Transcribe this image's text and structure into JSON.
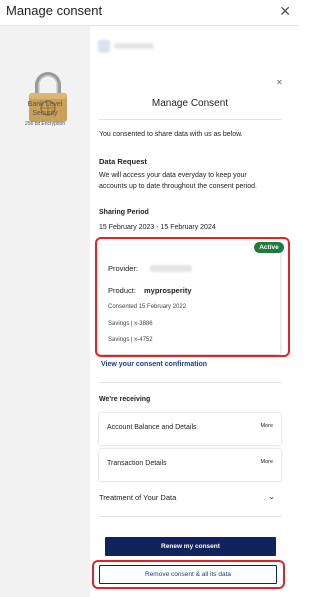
{
  "window": {
    "title": "Manage consent",
    "close_icon": "close-icon"
  },
  "security": {
    "label_line1": "Bank Level",
    "label_line2": "Security",
    "encryption": "256 bit Encryption"
  },
  "card": {
    "title": "Manage Consent",
    "intro": "You consented to share data with us as below.",
    "data_request": {
      "heading": "Data Request",
      "line1": "We will access your data everyday to keep your",
      "line2": "accounts up to date throughout the consent period."
    },
    "sharing_period": {
      "heading": "Sharing Period",
      "value": "15 February 2023 - 15 February 2024"
    },
    "provider": {
      "status": "Active",
      "provider_label": "Provider:",
      "product_label": "Product:",
      "product_value": "myprosperity",
      "consented": "Consented 15 February 2022",
      "account1": "Savings | x-3886",
      "account2": "Savings | x-4752"
    },
    "view_confirmation": "View your consent confirmation",
    "receiving": {
      "heading": "We're receiving",
      "items": [
        {
          "label": "Account Balance and Details",
          "more": "More"
        },
        {
          "label": "Transaction Details",
          "more": "More"
        }
      ]
    },
    "treatment": {
      "label": "Treatment of Your Data",
      "icon": "chevron-down-icon"
    },
    "renew_button": "Renew my consent",
    "remove_button": "Remove consent & all its data"
  },
  "colors": {
    "primary": "#10235c",
    "active": "#1e7a3e",
    "highlight": "#e0242c",
    "link": "#1a3a8a"
  }
}
